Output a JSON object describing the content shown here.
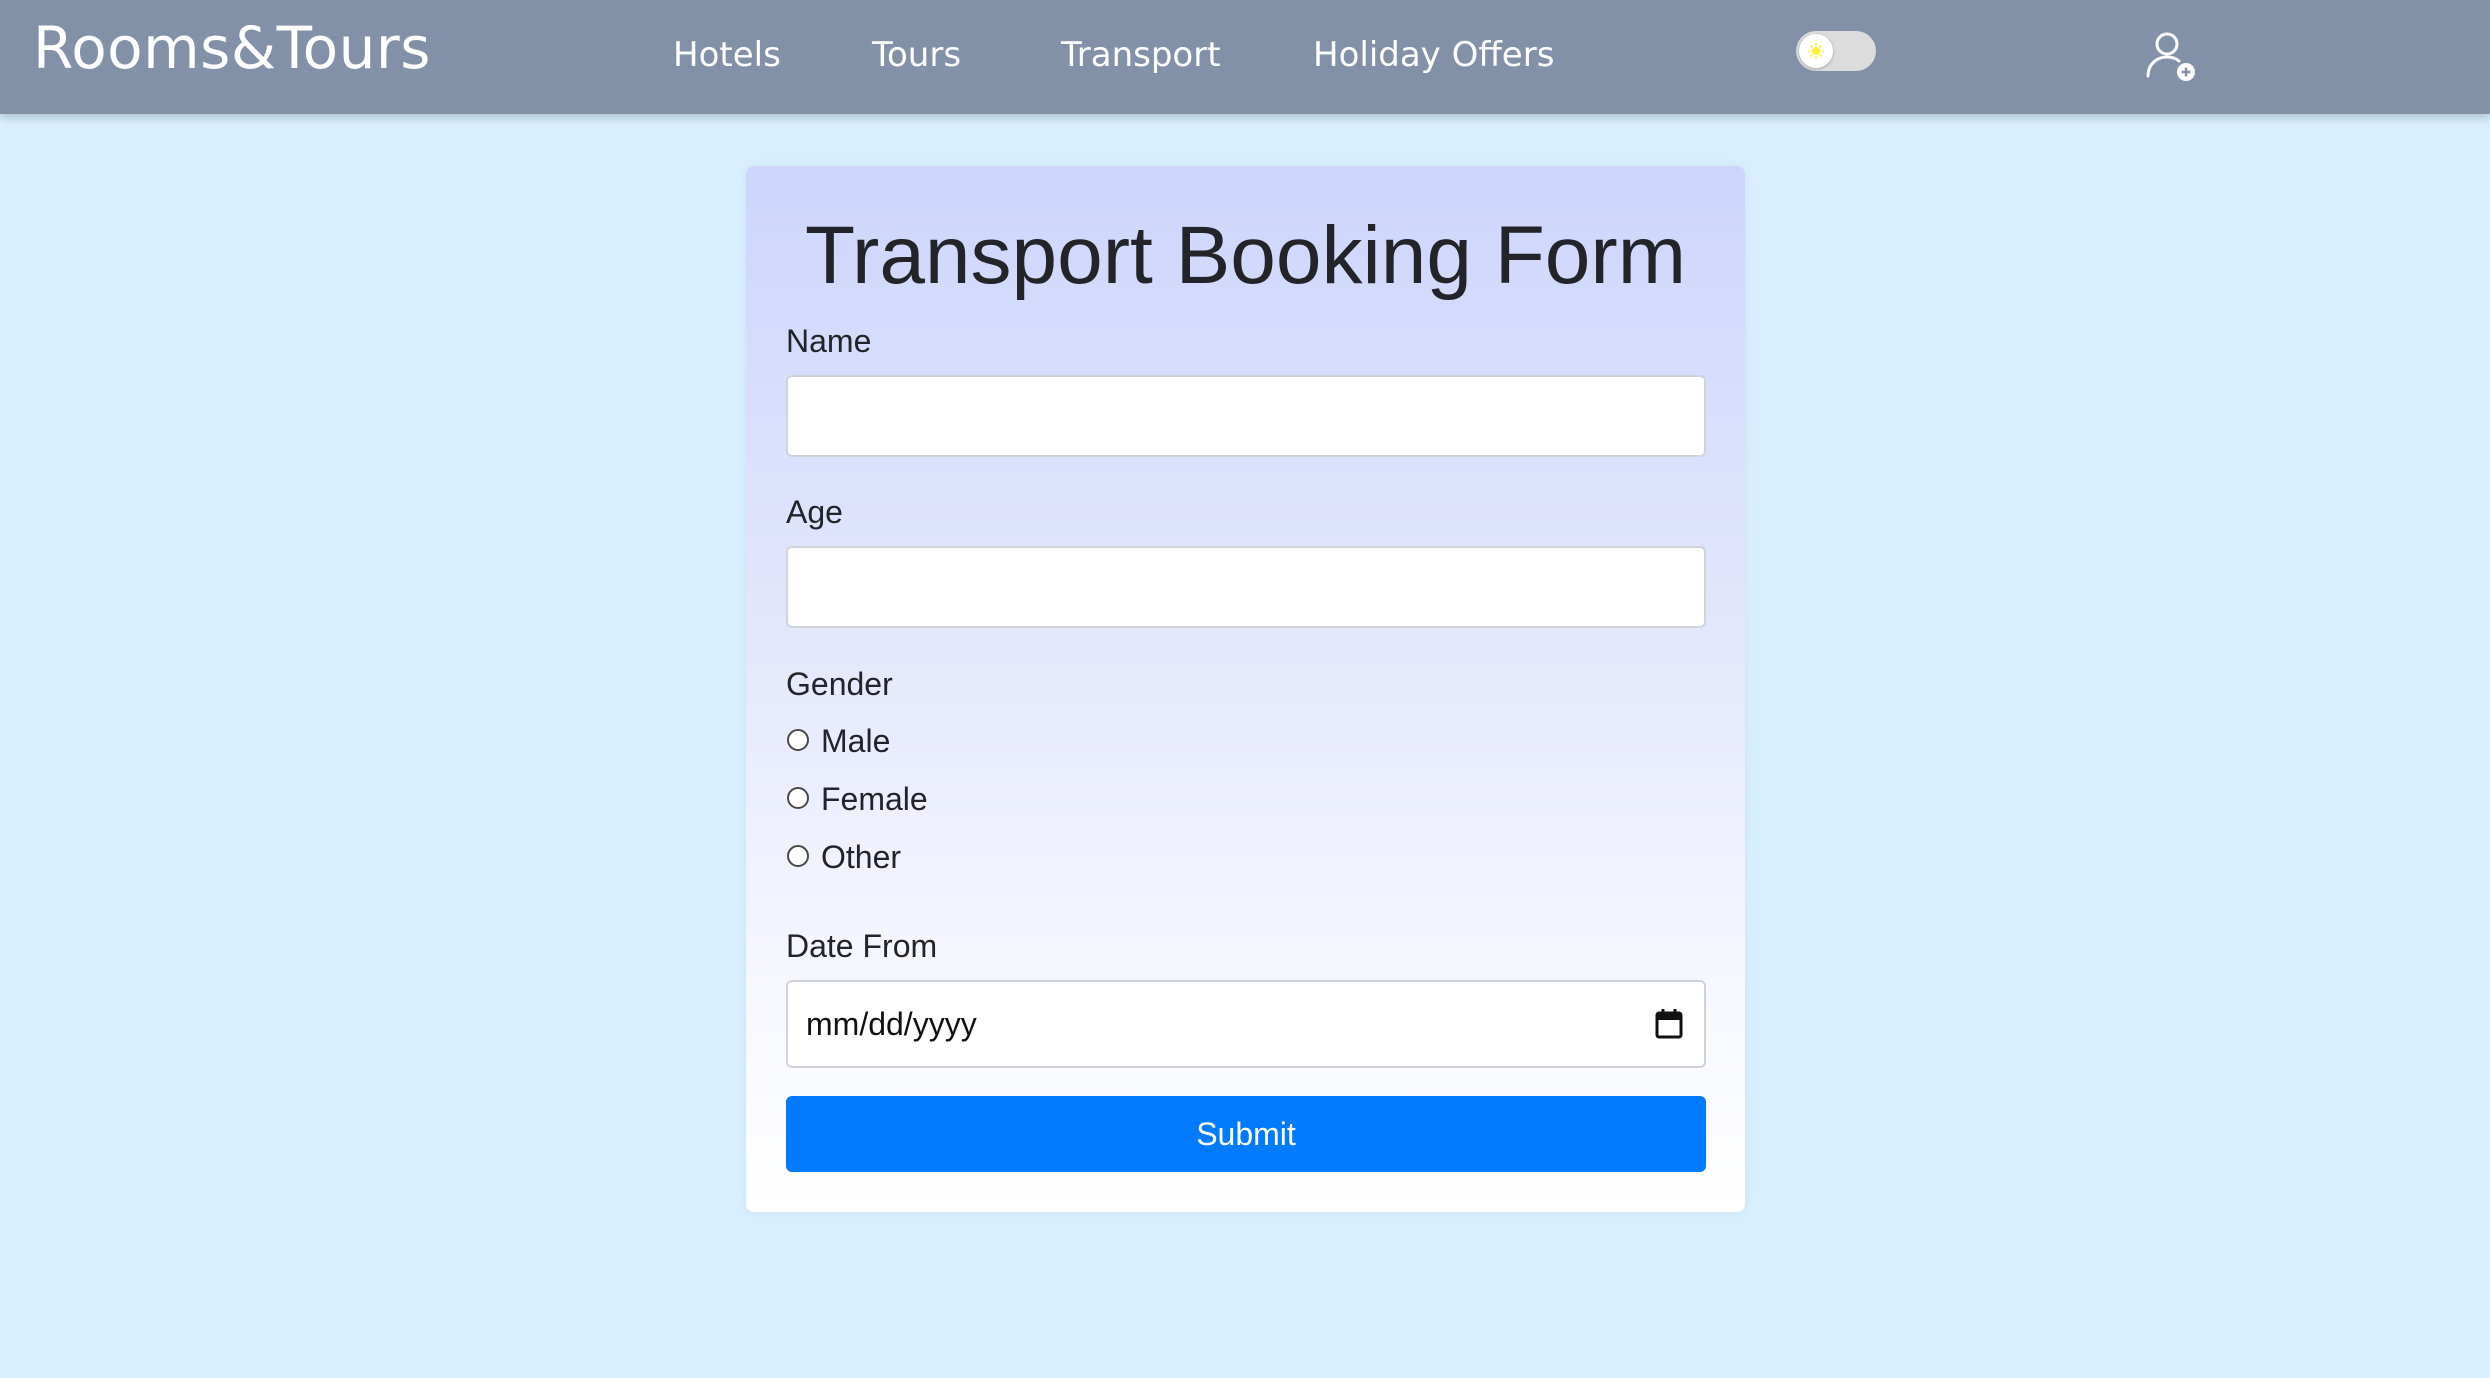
{
  "navbar": {
    "brand": "Rooms&Tours",
    "links": [
      {
        "label": "Hotels"
      },
      {
        "label": "Tours"
      },
      {
        "label": "Transport"
      },
      {
        "label": "Holiday Offers"
      }
    ],
    "theme_toggle": {
      "state": "light",
      "icon": "sun-icon"
    },
    "user_icon": "user-add-icon"
  },
  "form": {
    "title": "Transport Booking Form",
    "name": {
      "label": "Name",
      "value": ""
    },
    "age": {
      "label": "Age",
      "value": ""
    },
    "gender": {
      "label": "Gender",
      "options": [
        "Male",
        "Female",
        "Other"
      ],
      "selected": null
    },
    "date_from": {
      "label": "Date From",
      "placeholder": "mm/dd/yyyy"
    },
    "submit_label": "Submit"
  },
  "colors": {
    "navbar": "#8391a8",
    "background": "#d8efff",
    "primary": "#007bff",
    "sun": "#ffee33"
  }
}
